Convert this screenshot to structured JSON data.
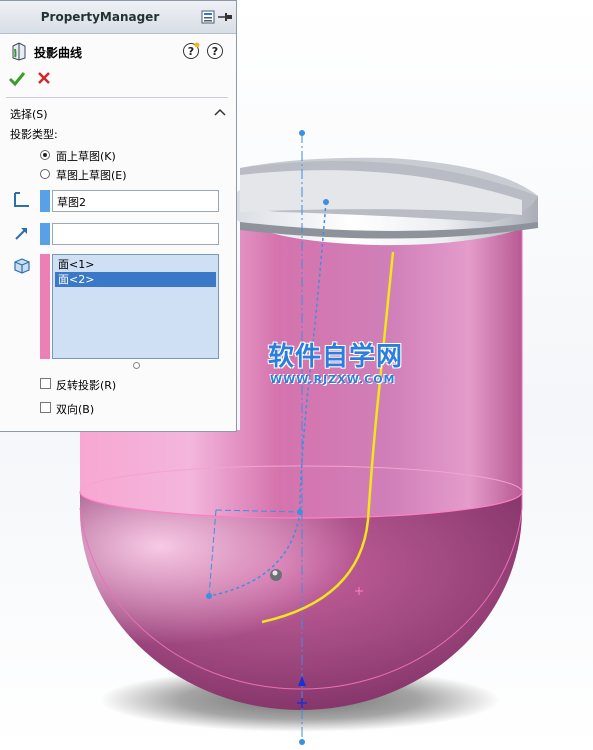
{
  "property_manager": {
    "title": "PropertyManager",
    "feature_name": "投影曲线",
    "section_title": "选择(S)",
    "projection_type_label": "投影类型:",
    "radio_options": [
      {
        "label": "面上草图(K)",
        "selected": true
      },
      {
        "label": "草图上草图(E)",
        "selected": false
      }
    ],
    "sketch_selection_value": "草图2",
    "direction_selection_value": "",
    "faces": [
      {
        "label": "面<1>",
        "selected": false
      },
      {
        "label": "面<2>",
        "selected": true
      }
    ],
    "checkboxes": [
      {
        "label": "反转投影(R)",
        "checked": false
      },
      {
        "label": "双向(B)",
        "checked": false
      }
    ]
  },
  "watermark": {
    "text": "软件自学网",
    "url": "WWW.RJZXW.COM"
  },
  "colors": {
    "part_pink": "#d86fab",
    "projected_curve": "#f2e51a",
    "sketch_blue": "#3d8fe0",
    "face_list_bg": "#cfe0f4"
  }
}
